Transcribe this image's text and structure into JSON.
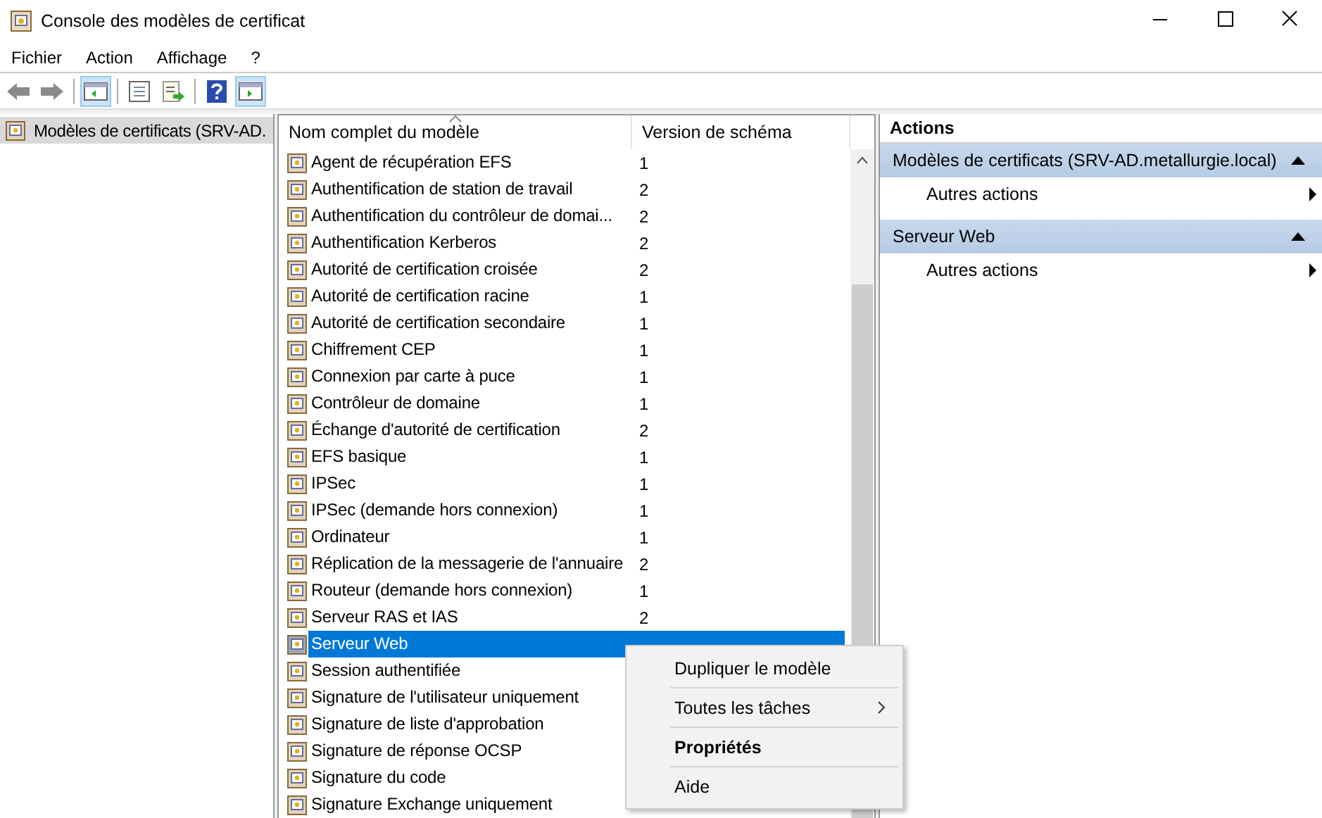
{
  "window": {
    "title": "Console des modèles de certificat"
  },
  "menu": [
    "Fichier",
    "Action",
    "Affichage",
    "?"
  ],
  "toolbar": [
    [
      {
        "kind": "back",
        "pressed": false
      },
      {
        "kind": "forward",
        "pressed": false
      }
    ],
    [
      {
        "kind": "tree",
        "pressed": true
      }
    ],
    [
      {
        "kind": "props",
        "pressed": false
      },
      {
        "kind": "export",
        "pressed": false
      }
    ],
    [
      {
        "kind": "help",
        "pressed": false
      },
      {
        "kind": "actionpane",
        "pressed": true
      }
    ]
  ],
  "tree": {
    "items": [
      {
        "label": "Modèles de certificats (SRV-AD.",
        "selected": true
      }
    ]
  },
  "table": {
    "columns": [
      "Nom complet du modèle",
      "Version de schéma"
    ],
    "rows": [
      {
        "name": "Agent de récupération EFS",
        "version": "1",
        "selected": false
      },
      {
        "name": "Authentification de station de travail",
        "version": "2",
        "selected": false
      },
      {
        "name": "Authentification du contrôleur de domai...",
        "version": "2",
        "selected": false
      },
      {
        "name": "Authentification Kerberos",
        "version": "2",
        "selected": false
      },
      {
        "name": "Autorité de certification croisée",
        "version": "2",
        "selected": false
      },
      {
        "name": "Autorité de certification racine",
        "version": "1",
        "selected": false
      },
      {
        "name": "Autorité de certification secondaire",
        "version": "1",
        "selected": false
      },
      {
        "name": "Chiffrement CEP",
        "version": "1",
        "selected": false
      },
      {
        "name": "Connexion par carte à puce",
        "version": "1",
        "selected": false
      },
      {
        "name": "Contrôleur de domaine",
        "version": "1",
        "selected": false
      },
      {
        "name": "Échange d'autorité de certification",
        "version": "2",
        "selected": false
      },
      {
        "name": "EFS basique",
        "version": "1",
        "selected": false
      },
      {
        "name": "IPSec",
        "version": "1",
        "selected": false
      },
      {
        "name": "IPSec (demande hors connexion)",
        "version": "1",
        "selected": false
      },
      {
        "name": "Ordinateur",
        "version": "1",
        "selected": false
      },
      {
        "name": "Réplication de la messagerie de l'annuaire",
        "version": "2",
        "selected": false
      },
      {
        "name": "Routeur (demande hors connexion)",
        "version": "1",
        "selected": false
      },
      {
        "name": "Serveur RAS et IAS",
        "version": "2",
        "selected": false
      },
      {
        "name": "Serveur Web",
        "selected": true
      },
      {
        "name": "Session authentifiée",
        "selected": false
      },
      {
        "name": "Signature de l'utilisateur uniquement",
        "selected": false
      },
      {
        "name": "Signature de liste d'approbation",
        "selected": false
      },
      {
        "name": "Signature de réponse OCSP",
        "selected": false
      },
      {
        "name": "Signature du code",
        "selected": false
      },
      {
        "name": "Signature Exchange uniquement",
        "selected": false
      }
    ]
  },
  "actions": {
    "title": "Actions",
    "sections": [
      {
        "title": "Modèles de certificats (SRV-AD.metallurgie.local)",
        "expanded": true,
        "items": [
          "Autres actions"
        ]
      },
      {
        "title": "Serveur Web",
        "expanded": true,
        "items": [
          "Autres actions"
        ]
      }
    ]
  },
  "context_menu": [
    {
      "label": "Dupliquer le modèle",
      "kind": "normal"
    },
    {
      "label": "Toutes les tâches",
      "kind": "submenu"
    },
    {
      "label": "Propriétés",
      "kind": "default"
    },
    {
      "label": "Aide",
      "kind": "normal"
    }
  ]
}
